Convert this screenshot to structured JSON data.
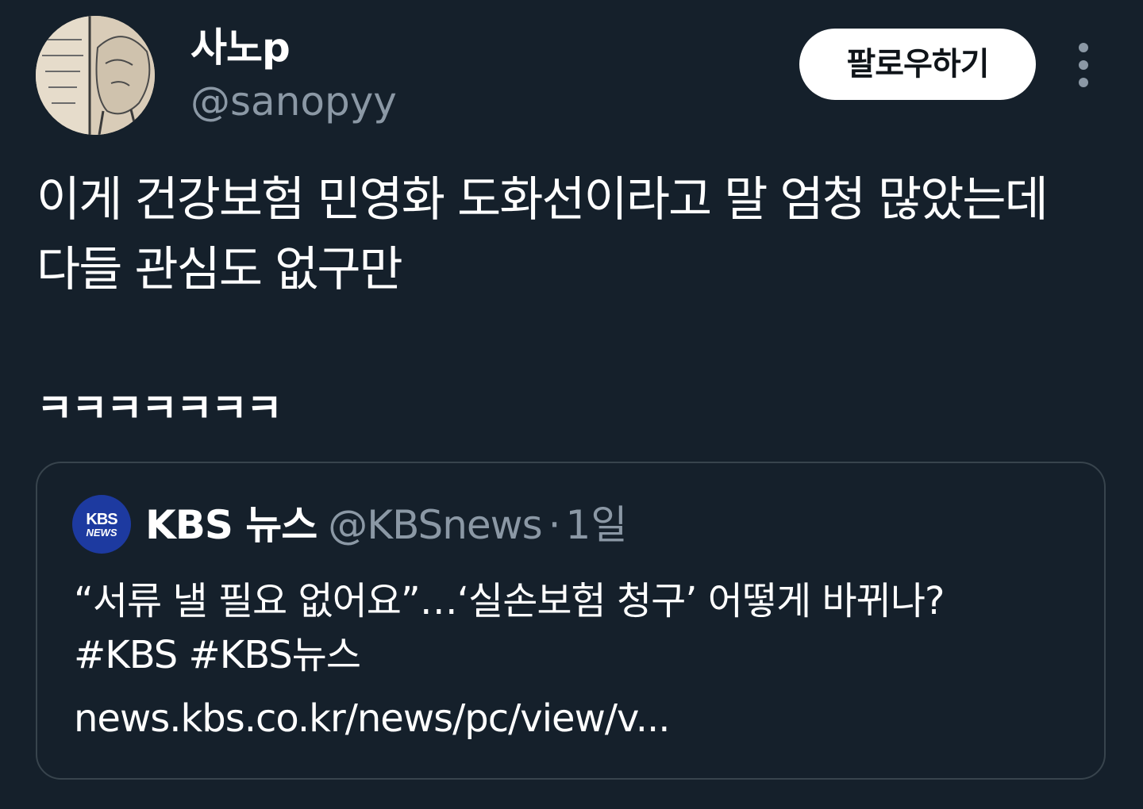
{
  "author": {
    "display_name": "사노p",
    "handle": "@sanopyy"
  },
  "follow_button_label": "팔로우하기",
  "tweet": {
    "text": "이게 건강보험 민영화 도화선이라고 말 엄청 많았는데\n다들 관심도 없구만",
    "extra": "ㅋㅋㅋㅋㅋㅋㅋ"
  },
  "quoted_tweet": {
    "avatar_text_line1": "KBS",
    "avatar_text_line2": "NEWS",
    "display_name": "KBS 뉴스",
    "handle": "@KBSnews",
    "separator": "·",
    "time": "1일",
    "text": "“서류 낼 필요 없어요”…‘실손보험 청구’ 어떻게 바뀌나?\n#KBS #KBS뉴스",
    "link": "news.kbs.co.kr/news/pc/view/v..."
  },
  "colors": {
    "background": "#15202b",
    "secondary_text": "#8b98a5",
    "card_border": "#38444d",
    "kbs_blue": "#1d3aa0"
  }
}
